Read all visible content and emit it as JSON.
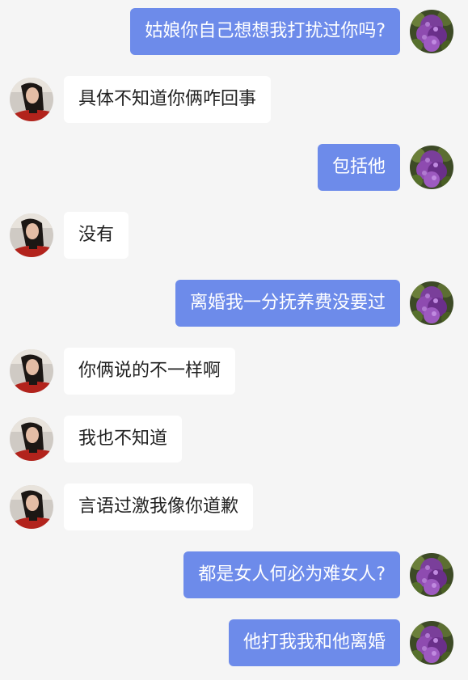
{
  "messages": [
    {
      "side": "out",
      "text": "姑娘你自己想想我打扰过你吗?"
    },
    {
      "side": "in",
      "text": "具体不知道你俩咋回事"
    },
    {
      "side": "out",
      "text": "包括他"
    },
    {
      "side": "in",
      "text": "没有"
    },
    {
      "side": "out",
      "text": "离婚我一分抚养费没要过"
    },
    {
      "side": "in",
      "text": "你俩说的不一样啊"
    },
    {
      "side": "in",
      "text": "我也不知道"
    },
    {
      "side": "in",
      "text": "言语过激我像你道歉"
    },
    {
      "side": "out",
      "text": "都是女人何必为难女人?"
    },
    {
      "side": "out",
      "text": "他打我我和他离婚"
    }
  ],
  "colors": {
    "background": "#f5f5f5",
    "outgoing_bubble": "#6d8bea",
    "incoming_bubble": "#ffffff"
  },
  "icons": {
    "incoming_avatar": "woman-portrait-avatar",
    "outgoing_avatar": "purple-flowers-avatar"
  }
}
